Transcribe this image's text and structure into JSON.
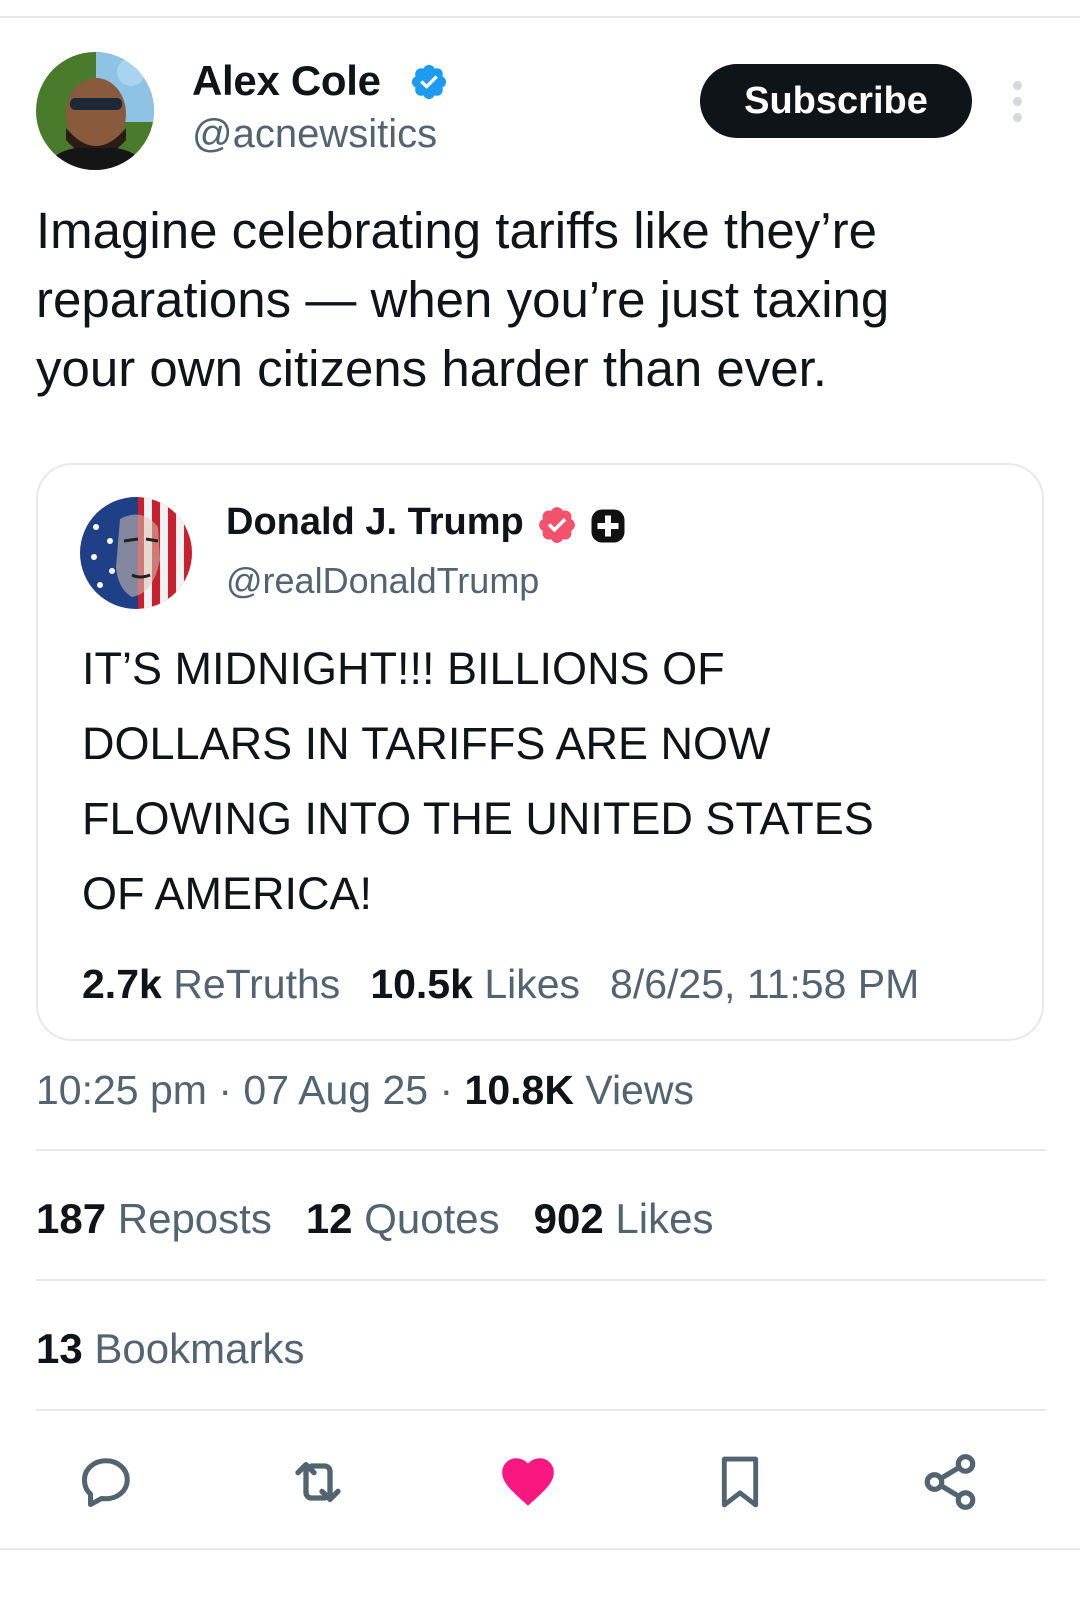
{
  "post": {
    "author_name": "Alex Cole",
    "author_handle": "@acnewsitics",
    "subscribe_label": "Subscribe",
    "text": "Imagine celebrating tariffs like they’re\nreparations — when you’re just taxing\nyour own citizens harder than ever.",
    "time": "10:25 pm",
    "date": "07 Aug 25",
    "views_count": "10.8K",
    "views_label": "Views",
    "reposts_count": "187",
    "reposts_label": "Reposts",
    "quotes_count": "12",
    "quotes_label": "Quotes",
    "likes_count": "902",
    "likes_label": "Likes",
    "bookmarks_count": "13",
    "bookmarks_label": "Bookmarks"
  },
  "quote": {
    "author_name": "Donald J. Trump",
    "author_handle": "@realDonaldTrump",
    "text": "IT’S MIDNIGHT!!! BILLIONS OF\nDOLLARS IN TARIFFS ARE NOW\nFLOWING INTO THE UNITED STATES\nOF AMERICA!",
    "retruths_count": "2.7k",
    "retruths_label": "ReTruths",
    "likes_count": "10.5k",
    "likes_label": "Likes",
    "timestamp": "8/6/25, 11:58 PM"
  },
  "actions": [
    {
      "icon": "reply-icon"
    },
    {
      "icon": "repost-icon"
    },
    {
      "icon": "heart-icon",
      "active": true
    },
    {
      "icon": "bookmark-icon"
    },
    {
      "icon": "share-icon"
    }
  ],
  "colors": {
    "text": "#0f1419",
    "secondary": "#536471",
    "border": "#e6e9ec",
    "verified_blue": "#1d9bf0",
    "truth_badge": "#f4516c",
    "like_active": "#f91880"
  }
}
